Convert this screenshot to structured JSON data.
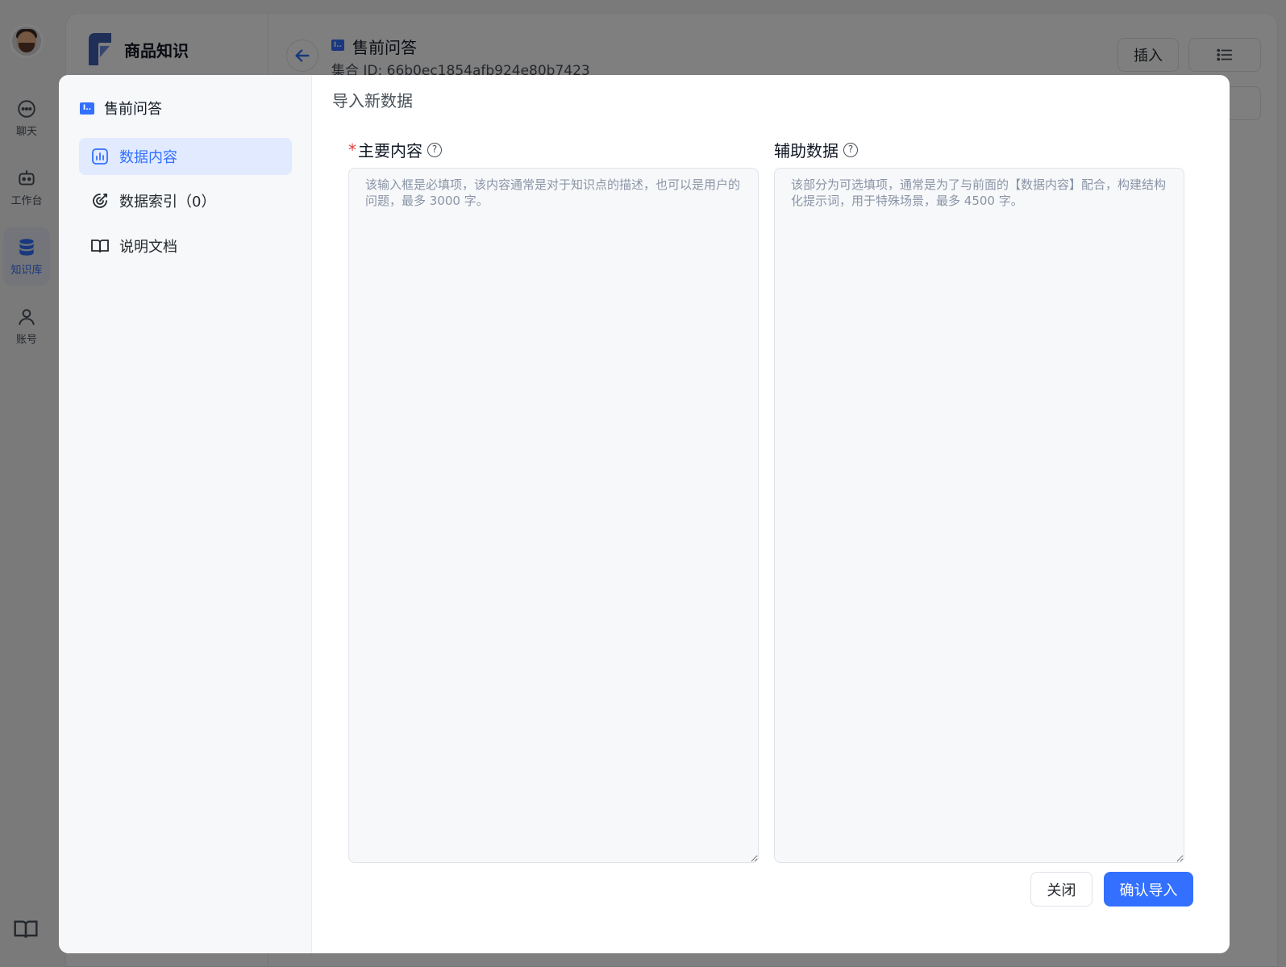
{
  "nav": {
    "items": [
      {
        "label": "聊天",
        "icon": "chat-icon"
      },
      {
        "label": "工作台",
        "icon": "robot-icon"
      },
      {
        "label": "知识库",
        "icon": "database-icon"
      },
      {
        "label": "账号",
        "icon": "user-icon"
      }
    ],
    "active": "知识库"
  },
  "app": {
    "name": "商品知识"
  },
  "header": {
    "collection_title": "售前问答",
    "collection_id": "集合 ID: 66b0ec1854afb924e80b7423",
    "insert_label": "插入"
  },
  "modal": {
    "side_title": "售前问答",
    "side_items": [
      {
        "label": "数据内容",
        "icon": "chart-bars-icon",
        "active": true
      },
      {
        "label": "数据索引（0）",
        "icon": "target-icon",
        "active": false
      },
      {
        "label": "说明文档",
        "icon": "book-icon",
        "active": false
      }
    ],
    "title": "导入新数据",
    "main_field": {
      "required_mark": "*",
      "label": "主要内容",
      "placeholder": "该输入框是必填项，该内容通常是对于知识点的描述，也可以是用户的问题，最多 3000 字。",
      "value": ""
    },
    "aux_field": {
      "label": "辅助数据",
      "placeholder": "该部分为可选填项，通常是为了与前面的【数据内容】配合，构建结构化提示词，用于特殊场景，最多 4500 字。",
      "value": ""
    },
    "close_label": "关闭",
    "confirm_label": "确认导入"
  },
  "colors": {
    "accent": "#3370ff",
    "overlay": "rgba(0,0,0,0.5)"
  }
}
